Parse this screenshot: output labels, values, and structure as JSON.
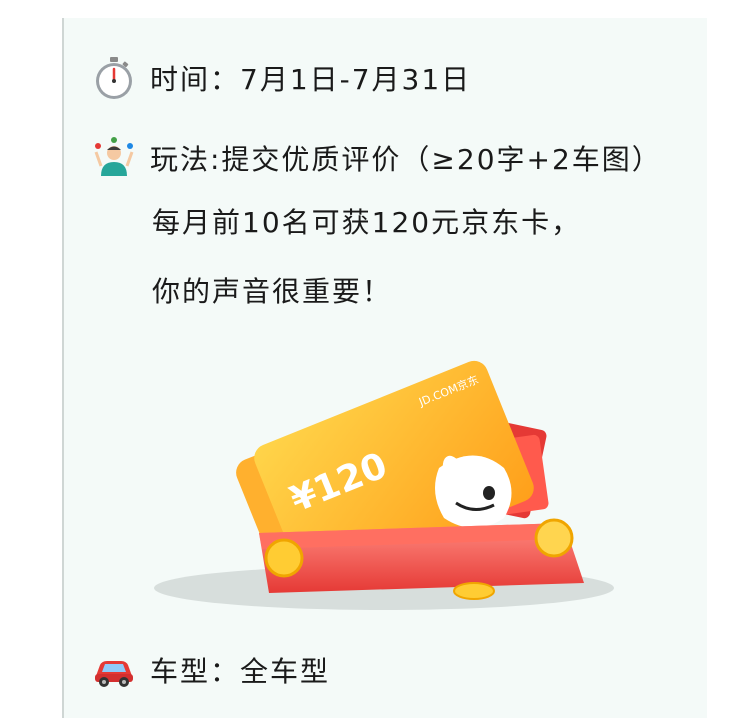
{
  "campaign": {
    "time_line": "时间：7月1日-7月31日",
    "play_line": "玩法:提交优质评价（≥20字+2车图）",
    "reward_line": "每月前10名可获120元京东卡，",
    "voice_line": "你的声音很重要！",
    "car_line": "车型：全车型"
  },
  "illustration": {
    "card_brand": "JD.COM京东",
    "card_value": "¥120"
  },
  "icons": {
    "time": "stopwatch-icon",
    "play": "juggler-icon",
    "car": "car-icon"
  }
}
